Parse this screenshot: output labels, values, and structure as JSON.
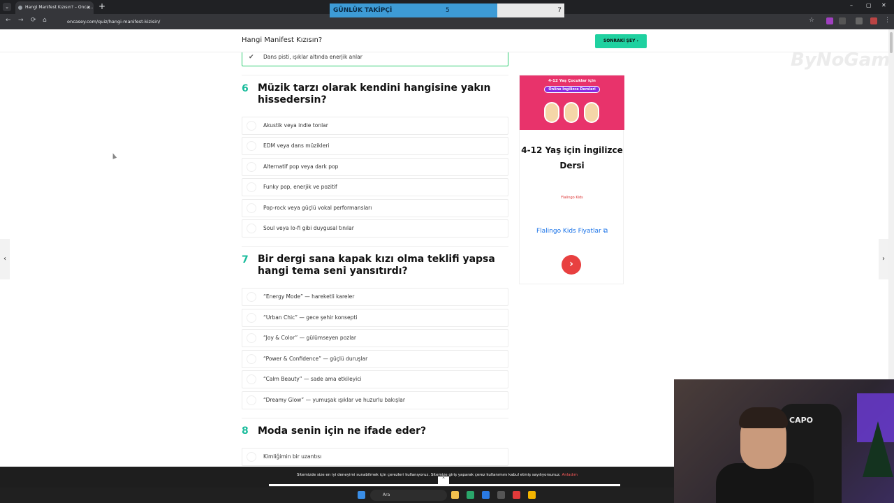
{
  "browser": {
    "tab_title": "Hangi Manifest Kızısın? – Onca...",
    "tab_close": "✕",
    "tab_dropdown": "⌄",
    "new_tab": "+",
    "url": "oncasey.com/quiz/hangi-manifest-kizisin/",
    "win_min": "–",
    "win_max": "▢",
    "win_close": "✕"
  },
  "follower_counter": {
    "label": "GÜNLÜK TAKİPÇİ",
    "current": "5",
    "goal": "7",
    "progress_fraction": 0.714,
    "fill_color": "#3d9bd6"
  },
  "site": {
    "title": "Hangi Manifest Kızısın?",
    "next_button": "SONRAKİ ŞEY",
    "accent": "#1fd1a0"
  },
  "quiz": {
    "selected_prev_option": "Dans pisti, ışıklar altında enerjik anlar",
    "questions": [
      {
        "number": "6",
        "text": "Müzik tarzı olarak kendini hangisine yakın hissedersin?",
        "options": [
          "Akustik veya indie tonlar",
          "EDM veya dans müzikleri",
          "Alternatif pop veya dark pop",
          "Funky pop, enerjik ve pozitif",
          "Pop-rock veya güçlü vokal performansları",
          "Soul veya lo-fi gibi duygusal tınılar"
        ]
      },
      {
        "number": "7",
        "text": "Bir dergi sana kapak kızı olma teklifi yapsa hangi tema seni yansıtırdı?",
        "options": [
          "“Energy Mode” — hareketli kareler",
          "“Urban Chic” — gece şehir konsepti",
          "“Joy & Color” — gülümseyen pozlar",
          "“Power & Confidence” — güçlü duruşlar",
          "“Calm Beauty” — sade ama etkileyici",
          "“Dreamy Glow” — yumuşak ışıklar ve huzurlu bakışlar"
        ]
      },
      {
        "number": "8",
        "text": "Moda senin için ne ifade eder?",
        "options": [
          "Kimliğimin bir uzantısı"
        ]
      }
    ]
  },
  "ad": {
    "banner_line1": "4-12 Yaş Çocuklar için",
    "banner_line2": "Online İngilizce Dersleri",
    "headline": "4-12 Yaş için İngilizce Dersi",
    "logo_text": "Flalingo Kids",
    "link_text": "Flalingo Kids Fiyatlar",
    "cta_arrow": "›",
    "brand_color": "#e8336b"
  },
  "watermark": "ByNoGame",
  "cookie": {
    "text": "Sitemizde size en iyi deneyimi sunabilmek için çerezleri kullanıyoruz. Sitemize giriş yaparak çerez kullanımını kabul etmiş sayılıyorsunuz.",
    "link": "Anladım",
    "up_arrow": "⌃"
  },
  "taskbar": {
    "search_placeholder": "Ara"
  },
  "webcam": {
    "chair_label": "CAPO"
  }
}
